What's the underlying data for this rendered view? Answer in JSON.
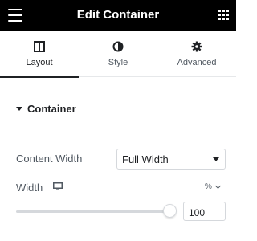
{
  "header": {
    "title": "Edit Container"
  },
  "tabs": [
    {
      "label": "Layout",
      "icon": "columns-icon",
      "active": true
    },
    {
      "label": "Style",
      "icon": "half-circle-icon",
      "active": false
    },
    {
      "label": "Advanced",
      "icon": "gear-icon",
      "active": false
    }
  ],
  "section": {
    "title": "Container"
  },
  "content_width": {
    "label": "Content Width",
    "value": "Full Width"
  },
  "width": {
    "label": "Width",
    "unit": "%",
    "value": "100",
    "slider_fraction": 1.0
  },
  "colors": {
    "header_bg": "#000000",
    "text": "#1f2124",
    "border": "#d5d8dc"
  }
}
